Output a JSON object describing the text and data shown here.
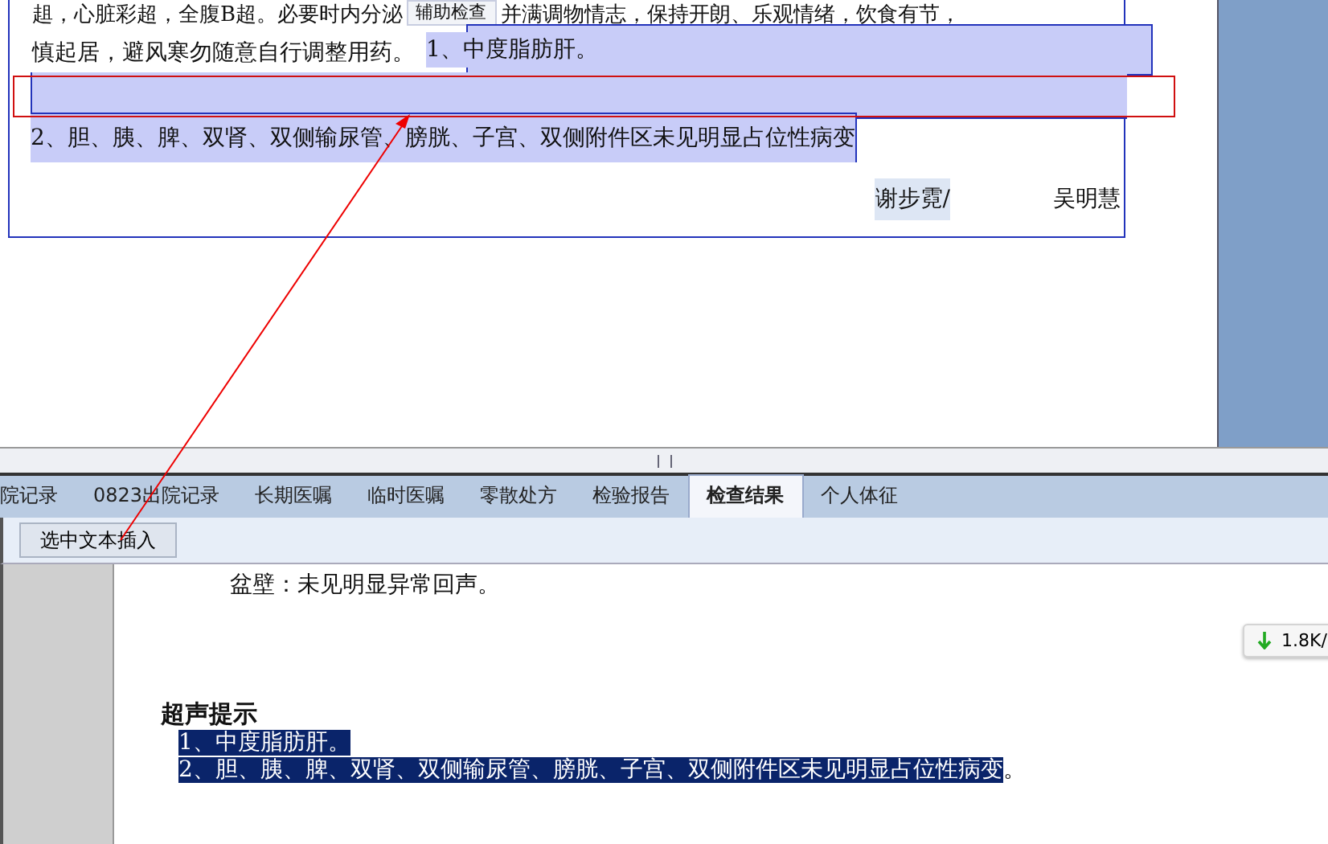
{
  "top_document": {
    "line_1": {
      "left": "趄，心脏彩超，全腹B超。必要时内分泌",
      "tooltip": "辅助检查",
      "right": "并满调物情志，保持开朗、乐观情绪，饮食有节，"
    },
    "line_2": {
      "text": "慎起居，避风寒勿随意自行调整用药。",
      "inserted": {
        "text": "1、中度脂肪肝。",
        "selected": true
      }
    },
    "inserted_line": {
      "text": "2、胆、胰、脾、双肾、双侧输尿管、膀胱、子宫、双侧附件区未见明显占位性病变",
      "selected": true
    },
    "signatures": [
      {
        "text": "谢步霓/",
        "selected": true
      },
      {
        "text": "吴明慧",
        "selected": false
      }
    ]
  },
  "tabs": [
    {
      "label": "院记录",
      "selected": false
    },
    {
      "label": "0823出院记录",
      "selected": false
    },
    {
      "label": "长期医嘱",
      "selected": false
    },
    {
      "label": "临时医嘱",
      "selected": false
    },
    {
      "label": "零散处方",
      "selected": false
    },
    {
      "label": "检验报告",
      "selected": false
    },
    {
      "label": "检查结果",
      "selected": true
    },
    {
      "label": "个人体征",
      "selected": false
    }
  ],
  "toolbar": {
    "button": "选中文本插入"
  },
  "report": {
    "line": "盆壁：未见明显异常回声。",
    "heading": "超声提示",
    "conclusions": [
      {
        "text": "1、中度脂肪肝。",
        "selected": true
      },
      {
        "text": "2、胆、胰、脾、双肾、双侧输尿管、膀胱、子宫、双侧附件区未见明显占位性病变",
        "selected": true,
        "tail": "。"
      }
    ]
  },
  "speed_badge": {
    "text": "1.8K/"
  }
}
